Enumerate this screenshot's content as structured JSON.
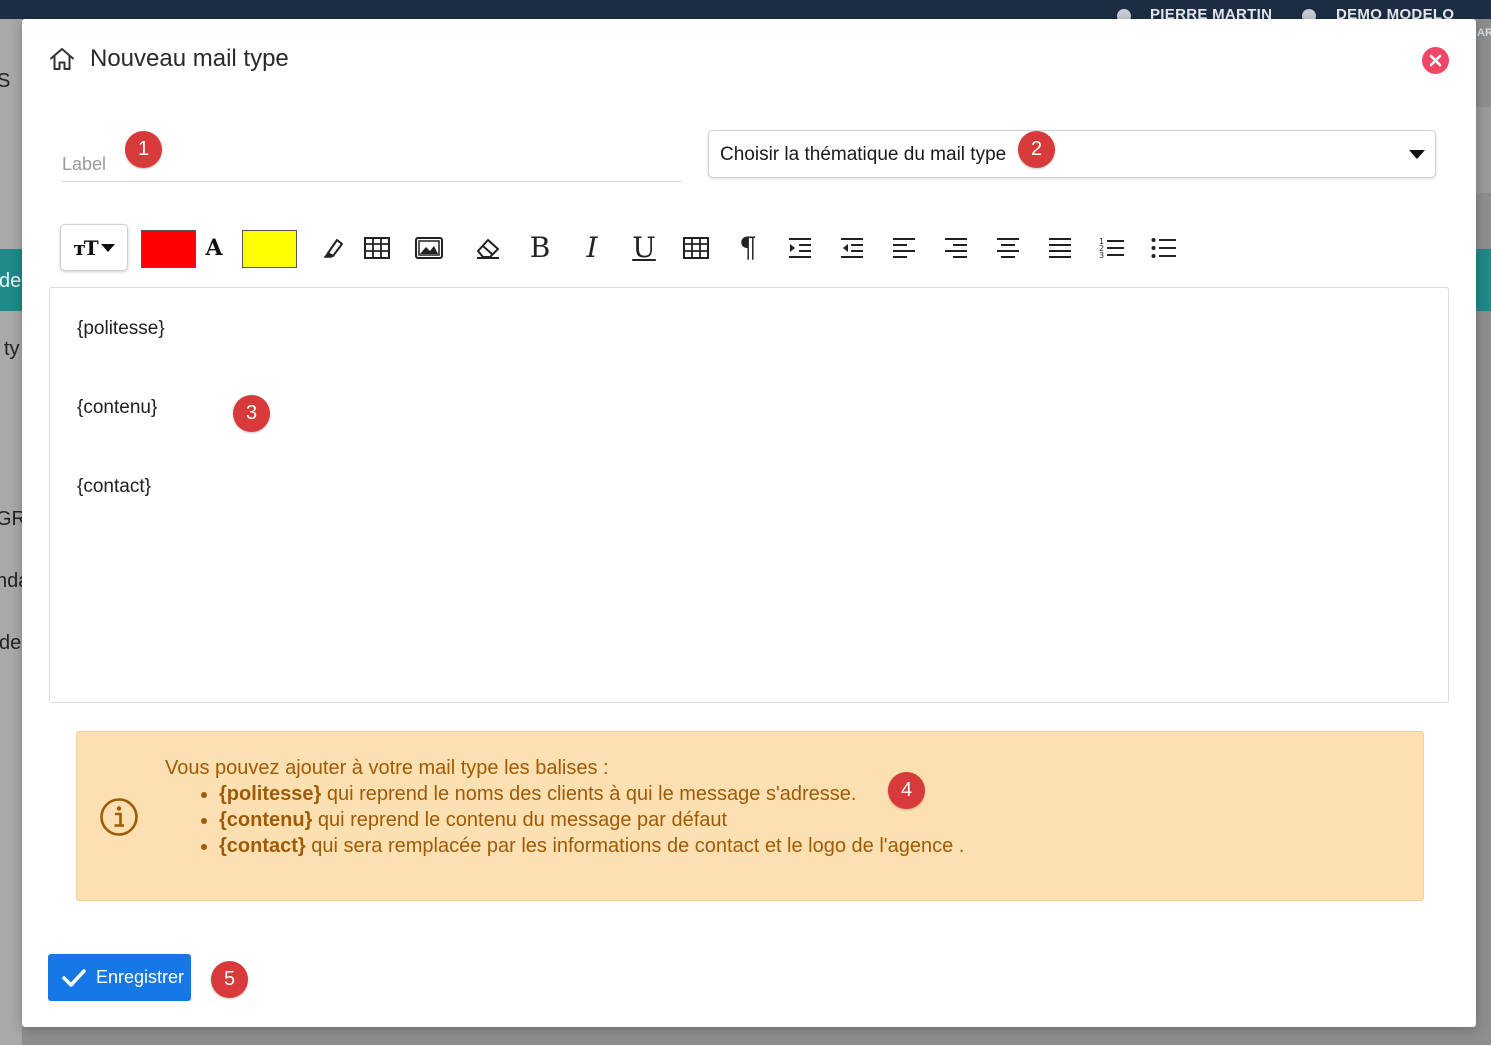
{
  "background": {
    "users": [
      "PIERRE MARTIN",
      "DEMO MODELO"
    ],
    "right_edge_text": "AR",
    "left_fragments": [
      "S",
      "de",
      "ty",
      "GRU",
      "nda",
      "de v"
    ]
  },
  "modal": {
    "title": "Nouveau mail type",
    "label_placeholder": "Label",
    "theme_select_value": "Choisir la thématique du mail type",
    "toolbar": {
      "font_size_label": "тT",
      "font_color": "#ff0000",
      "font_color_letter": "A",
      "highlight_color": "#ffff00"
    },
    "editor_lines": [
      "{politesse}",
      "{contenu}",
      "{contact}"
    ],
    "info": {
      "intro": "Vous pouvez ajouter à votre mail type les balises :",
      "items": [
        {
          "tag": "{politesse}",
          "text": " qui reprend le noms des clients à qui le message s'adresse."
        },
        {
          "tag": "{contenu}",
          "text": " qui reprend le contenu du message par défaut"
        },
        {
          "tag": "{contact}",
          "text": " qui sera remplacée par les informations de contact et le logo de l'agence ."
        }
      ]
    },
    "save_label": "Enregistrer"
  },
  "badges": [
    "1",
    "2",
    "3",
    "4",
    "5"
  ],
  "colors": {
    "accent": "#1677e6",
    "badge": "#d8393a",
    "close": "#ef4765",
    "info_bg": "#fde0b2",
    "info_text": "#a05a05"
  }
}
